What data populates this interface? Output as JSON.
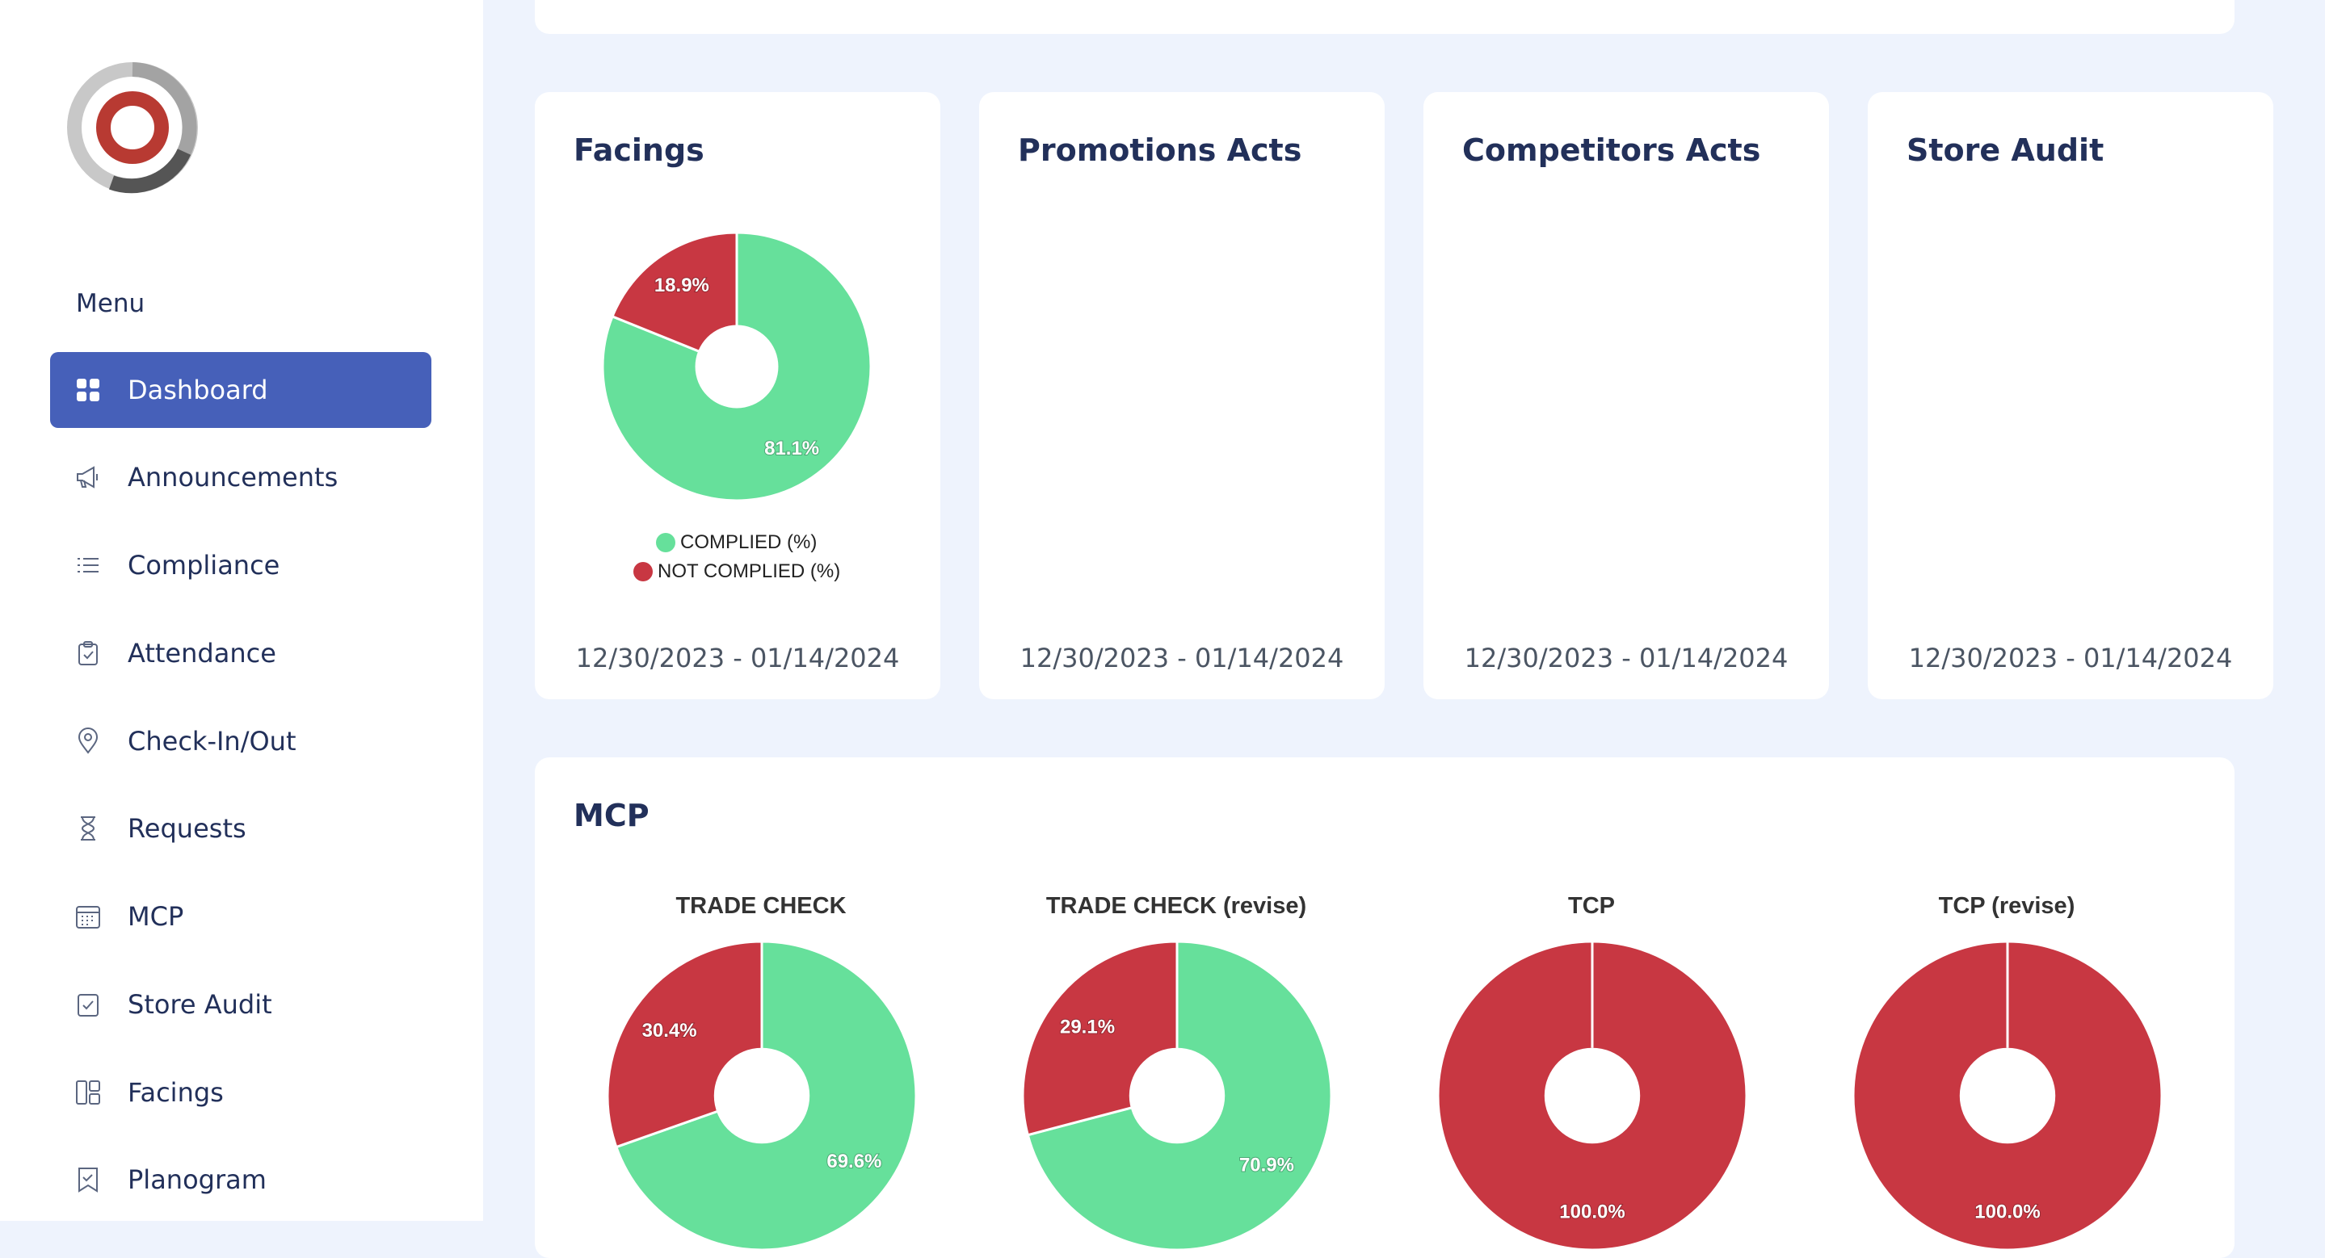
{
  "sidebar": {
    "menu_heading": "Menu",
    "items": [
      {
        "label": "Dashboard",
        "icon": "dashboard-grid-icon",
        "active": true
      },
      {
        "label": "Announcements",
        "icon": "megaphone-icon"
      },
      {
        "label": "Compliance",
        "icon": "checklist-icon"
      },
      {
        "label": "Attendance",
        "icon": "clipboard-icon"
      },
      {
        "label": "Check-In/Out",
        "icon": "location-pin-icon"
      },
      {
        "label": "Requests",
        "icon": "hourglass-icon"
      },
      {
        "label": "MCP",
        "icon": "calendar-icon"
      },
      {
        "label": "Store Audit",
        "icon": "audit-check-icon"
      },
      {
        "label": "Facings",
        "icon": "layout-panels-icon"
      },
      {
        "label": "Planogram",
        "icon": "bookmark-check-icon"
      }
    ]
  },
  "colors": {
    "accent": "#4660b9",
    "complied": "#66e09b",
    "not_complied": "#c83742",
    "background": "#eef3fd"
  },
  "cards": [
    {
      "title": "Facings",
      "range": "12/30/2023 - 01/14/2024"
    },
    {
      "title": "Promotions Acts",
      "range": "12/30/2023 - 01/14/2024"
    },
    {
      "title": "Competitors Acts",
      "range": "12/30/2023 - 01/14/2024"
    },
    {
      "title": "Store Audit",
      "range": "12/30/2023 - 01/14/2024"
    }
  ],
  "facings_legend": {
    "complied": "COMPLIED (%)",
    "not_complied": "NOT COMPLIED (%)"
  },
  "mcp": {
    "title": "MCP"
  },
  "chart_data": [
    {
      "type": "pie",
      "title": "",
      "categories": [
        "COMPLIED (%)",
        "NOT COMPLIED (%)"
      ],
      "values": [
        81.1,
        18.9
      ],
      "labels": [
        "81.1%",
        "18.9%"
      ]
    },
    {
      "type": "pie",
      "title": "TRADE CHECK",
      "categories": [
        "COMPLIED (%)",
        "NOT COMPLIED (%)"
      ],
      "values": [
        69.6,
        30.4
      ],
      "labels": [
        "69.6%",
        "30.4%"
      ]
    },
    {
      "type": "pie",
      "title": "TRADE CHECK (revise)",
      "categories": [
        "COMPLIED (%)",
        "NOT COMPLIED (%)"
      ],
      "values": [
        70.9,
        29.1
      ],
      "labels": [
        "70.9%",
        "29.1%"
      ]
    },
    {
      "type": "pie",
      "title": "TCP",
      "categories": [
        "COMPLIED (%)",
        "NOT COMPLIED (%)"
      ],
      "values": [
        0,
        100.0
      ],
      "labels": [
        "",
        "100.0%"
      ]
    },
    {
      "type": "pie",
      "title": "TCP (revise)",
      "categories": [
        "COMPLIED (%)",
        "NOT COMPLIED (%)"
      ],
      "values": [
        0,
        100.0
      ],
      "labels": [
        "",
        "100.0%"
      ]
    }
  ]
}
